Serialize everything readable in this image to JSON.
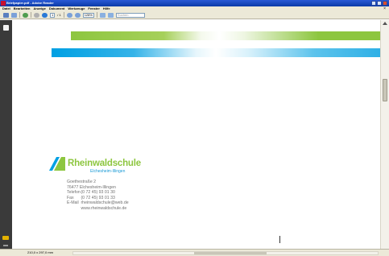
{
  "window": {
    "title": "Briefpapier.pdf - Adobe Reader"
  },
  "menubar": {
    "items": [
      "Datei",
      "Bearbeiten",
      "Anzeige",
      "Dokument",
      "Werkzeuge",
      "Fenster",
      "Hilfe"
    ]
  },
  "toolbar": {
    "page_number": "1",
    "page_total": "/ 1",
    "zoom": "128%",
    "search_placeholder": "Suchen"
  },
  "document": {
    "brand_name": "Rheinwaldschule",
    "brand_sub": "Elchesheim-Illingen",
    "address": {
      "street": "Goethestraße 2",
      "city": "76477 Elchesheim-Illingen",
      "phone_label": "Telefon",
      "phone": "(0 72 45) 93 01 30",
      "fax_label": "Fax",
      "fax": "(0 72 45) 93 01 33",
      "email_label": "E-Mail",
      "email": "rheinwaldschule@web.de",
      "web": "www.rheinwaldschule.de"
    },
    "colors": {
      "green": "#8dc63f",
      "blue": "#00a0e3"
    }
  },
  "statusbar": {
    "page_size": "210,0 x 297,0 mm"
  }
}
